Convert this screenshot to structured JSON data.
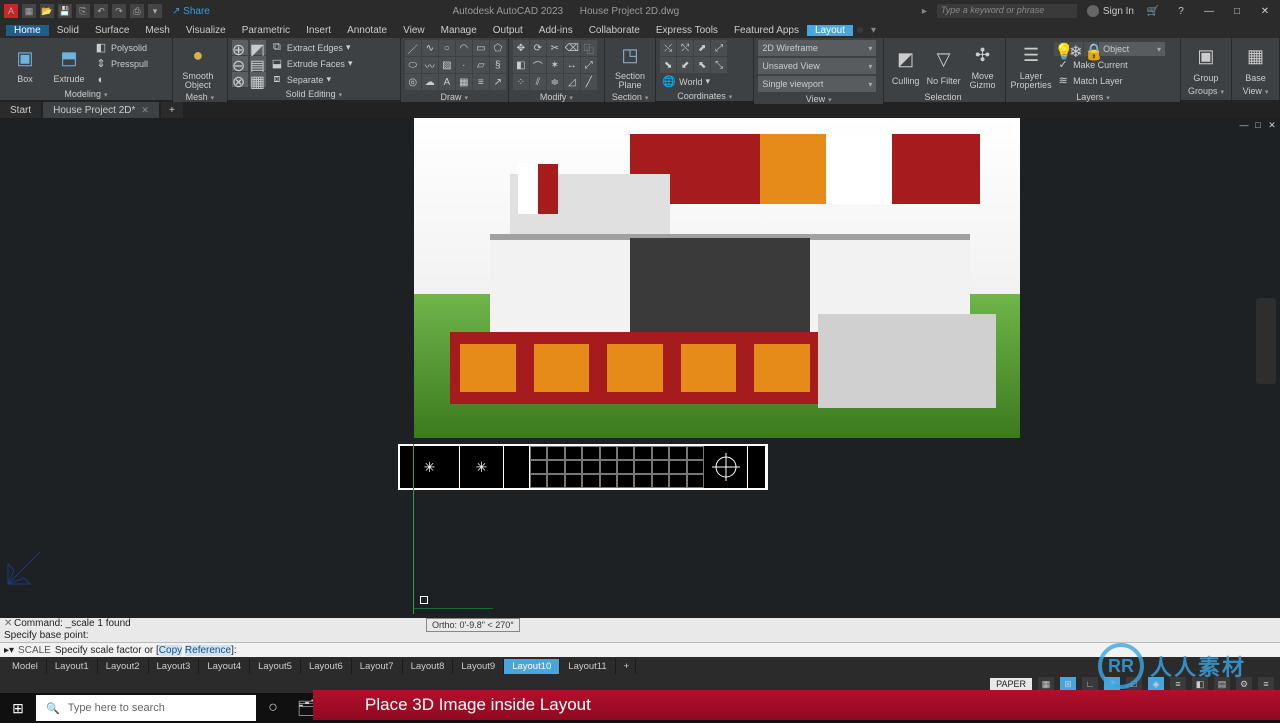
{
  "app": {
    "title": "Autodesk AutoCAD 2023",
    "doc": "House Project 2D.dwg"
  },
  "titlebar": {
    "share": "Share",
    "search_placeholder": "Type a keyword or phrase",
    "signin": "Sign In"
  },
  "menu": {
    "items": [
      "Home",
      "Solid",
      "Surface",
      "Mesh",
      "Visualize",
      "Parametric",
      "Insert",
      "Annotate",
      "View",
      "Manage",
      "Output",
      "Add-ins",
      "Collaborate",
      "Express Tools",
      "Featured Apps",
      "Layout"
    ],
    "active": "Home",
    "selected": "Layout"
  },
  "ribbon": {
    "modeling": {
      "label": "Modeling",
      "box": "Box",
      "extrude": "Extrude",
      "polysolid": "Polysolid",
      "presspull": "Presspull"
    },
    "mesh": {
      "label": "Mesh",
      "smooth": "Smooth\nObject"
    },
    "solidedit": {
      "label": "Solid Editing",
      "extractedges": "Extract Edges",
      "extrudefaces": "Extrude Faces",
      "separate": "Separate"
    },
    "draw": {
      "label": "Draw"
    },
    "modify": {
      "label": "Modify"
    },
    "section": {
      "label": "Section",
      "plane": "Section\nPlane"
    },
    "coords": {
      "label": "Coordinates",
      "world": "World"
    },
    "viewdd": {
      "label": "View",
      "wire": "2D Wireframe",
      "unsaved": "Unsaved View",
      "single": "Single viewport"
    },
    "selection": {
      "label": "Selection",
      "culling": "Culling",
      "nofilter": "No Filter",
      "gizmo": "Move\nGizmo"
    },
    "layers": {
      "label": "Layers",
      "props": "Layer\nProperties",
      "object": "Object",
      "makecurrent": "Make Current",
      "match": "Match Layer"
    },
    "groups": {
      "label": "Groups",
      "group": "Group"
    },
    "view": {
      "label": "View",
      "base": "Base"
    }
  },
  "filetabs": {
    "start": "Start",
    "doc": "House Project 2D*",
    "plus": "+"
  },
  "canvas": {
    "tooltip": "Ortho: 0'-9.8\" < 270°"
  },
  "cmd": {
    "l1": "Command: _scale 1 found",
    "l2": "Specify base point:",
    "prefix": "SCALE",
    "prompt": "Specify scale factor or [",
    "opt1": "Copy",
    "opt2": "Reference",
    "suffix": "]:"
  },
  "layouts": {
    "items": [
      "Model",
      "Layout1",
      "Layout2",
      "Layout3",
      "Layout4",
      "Layout5",
      "Layout6",
      "Layout7",
      "Layout8",
      "Layout9",
      "Layout10",
      "Layout11"
    ],
    "active": "Layout10"
  },
  "status": {
    "paper": "PAPER"
  },
  "taskbar": {
    "search_placeholder": "Type here to search"
  },
  "banner": {
    "text": "Place 3D Image inside Layout"
  },
  "watermark": {
    "text": "人人素材"
  }
}
